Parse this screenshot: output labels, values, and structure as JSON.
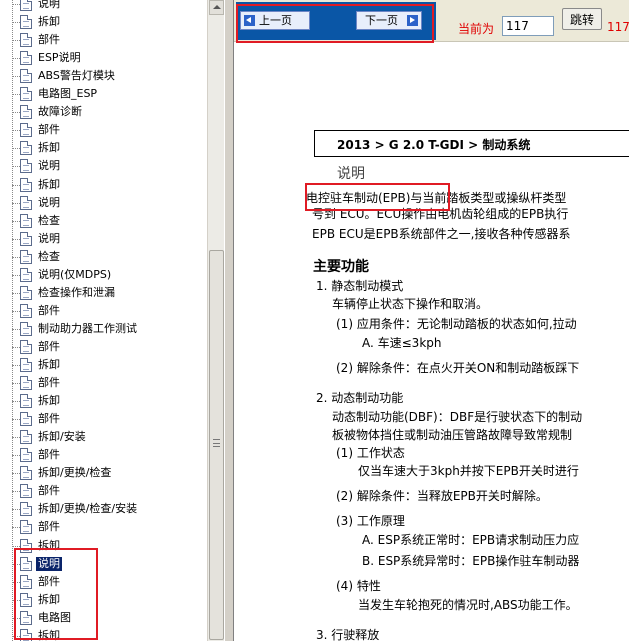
{
  "tree": {
    "items": [
      {
        "label": "说明",
        "selected": false
      },
      {
        "label": "拆卸",
        "selected": false
      },
      {
        "label": "部件",
        "selected": false
      },
      {
        "label": "ESP说明",
        "selected": false
      },
      {
        "label": "ABS警告灯模块",
        "selected": false
      },
      {
        "label": "电路图_ESP",
        "selected": false
      },
      {
        "label": "故障诊断",
        "selected": false
      },
      {
        "label": "部件",
        "selected": false
      },
      {
        "label": "拆卸",
        "selected": false
      },
      {
        "label": "说明",
        "selected": false
      },
      {
        "label": "拆卸",
        "selected": false
      },
      {
        "label": "说明",
        "selected": false
      },
      {
        "label": "检查",
        "selected": false
      },
      {
        "label": "说明",
        "selected": false
      },
      {
        "label": "检查",
        "selected": false
      },
      {
        "label": "说明(仅MDPS)",
        "selected": false
      },
      {
        "label": "检查操作和泄漏",
        "selected": false
      },
      {
        "label": "部件",
        "selected": false
      },
      {
        "label": "制动助力器工作测试",
        "selected": false
      },
      {
        "label": "部件",
        "selected": false
      },
      {
        "label": "拆卸",
        "selected": false
      },
      {
        "label": "部件",
        "selected": false
      },
      {
        "label": "拆卸",
        "selected": false
      },
      {
        "label": "部件",
        "selected": false
      },
      {
        "label": "拆卸/安装",
        "selected": false
      },
      {
        "label": "部件",
        "selected": false
      },
      {
        "label": "拆卸/更换/检查",
        "selected": false
      },
      {
        "label": "部件",
        "selected": false
      },
      {
        "label": "拆卸/更换/检查/安装",
        "selected": false
      },
      {
        "label": "部件",
        "selected": false
      },
      {
        "label": "拆卸",
        "selected": false
      },
      {
        "label": "说明",
        "selected": true
      },
      {
        "label": "部件",
        "selected": false
      },
      {
        "label": "拆卸",
        "selected": false
      },
      {
        "label": "电路图",
        "selected": false
      },
      {
        "label": "拆卸",
        "selected": false
      }
    ]
  },
  "toolbar": {
    "prev_label": "上一页",
    "next_label": "下一页",
    "current_label": "当前为",
    "page_value": "117",
    "jump_label": "跳转",
    "total_pages": "117"
  },
  "document": {
    "breadcrumb": "2013 > G 2.0 T-GDI > 制动系统",
    "section_title": "说明",
    "lines": [
      "电控驻车制动(EPB)与当前踏板类型或操纵杆类型",
      "号到 ECU。ECU操作由电机齿轮组成的EPB执行",
      "EPB ECU是EPB系统部件之一,接收各种传感器系",
      "1. 静态制动模式",
      "车辆停止状态下操作和取消。",
      "(1) 应用条件：无论制动踏板的状态如何,拉动",
      "A. 车速≤3kph",
      "(2) 解除条件：在点火开关ON和制动踏板踩下",
      "2. 动态制动功能",
      "动态制动功能(DBF)：DBF是行驶状态下的制动",
      "板被物体挡住或制动油压管路故障导致常规制",
      "(1) 工作状态",
      "仅当车速大于3kph并按下EPB开关时进行",
      "(2) 解除条件：当释放EPB开关时解除。",
      "(3) 工作原理",
      "A. ESP系统正常时：EPB请求制动压力应",
      "B. ESP系统异常时：EPB操作驻车制动器",
      "(4) 特性",
      "当发生车轮抱死的情况时,ABS功能工作。",
      "3. 行驶释放"
    ],
    "main_heading": "主要功能"
  },
  "colors": {
    "nav_box": "#0a56a6",
    "highlight": "#e01b24",
    "selected_bg": "#0a246a",
    "red_text": "#e00000"
  }
}
